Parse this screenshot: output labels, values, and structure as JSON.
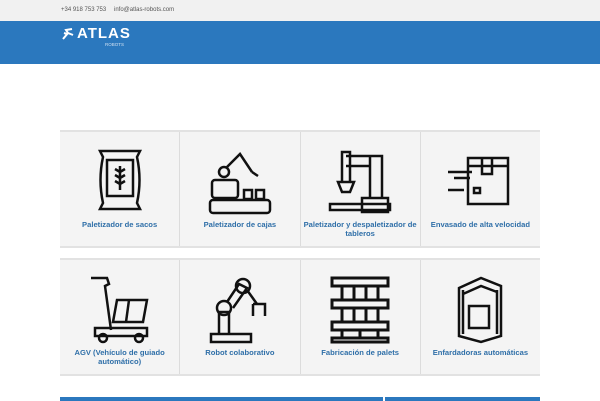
{
  "topbar": {
    "phone": "+34 918 753 753",
    "email": "info@atlas-robots.com"
  },
  "logo": {
    "name": "ATLAS",
    "sub": "ROBOTS"
  },
  "colors": {
    "brand": "#2b78be",
    "label": "#2f6fa8"
  },
  "products": [
    {
      "label": "Paletizador de sacos",
      "icon": "sack-icon"
    },
    {
      "label": "Paletizador de cajas",
      "icon": "robot-arm-conveyor-icon"
    },
    {
      "label": "Paletizador y despaletizador de tableros",
      "icon": "gantry-robot-icon"
    },
    {
      "label": "Envasado de alta velocidad",
      "icon": "fast-box-icon"
    },
    {
      "label": "AGV (Vehículo de guiado automático)",
      "icon": "agv-cart-icon"
    },
    {
      "label": "Robot colaborativo",
      "icon": "cobot-arm-icon"
    },
    {
      "label": "Fabricación de palets",
      "icon": "pallet-icon"
    },
    {
      "label": "Enfardadoras automáticas",
      "icon": "wrapping-machine-icon"
    }
  ]
}
